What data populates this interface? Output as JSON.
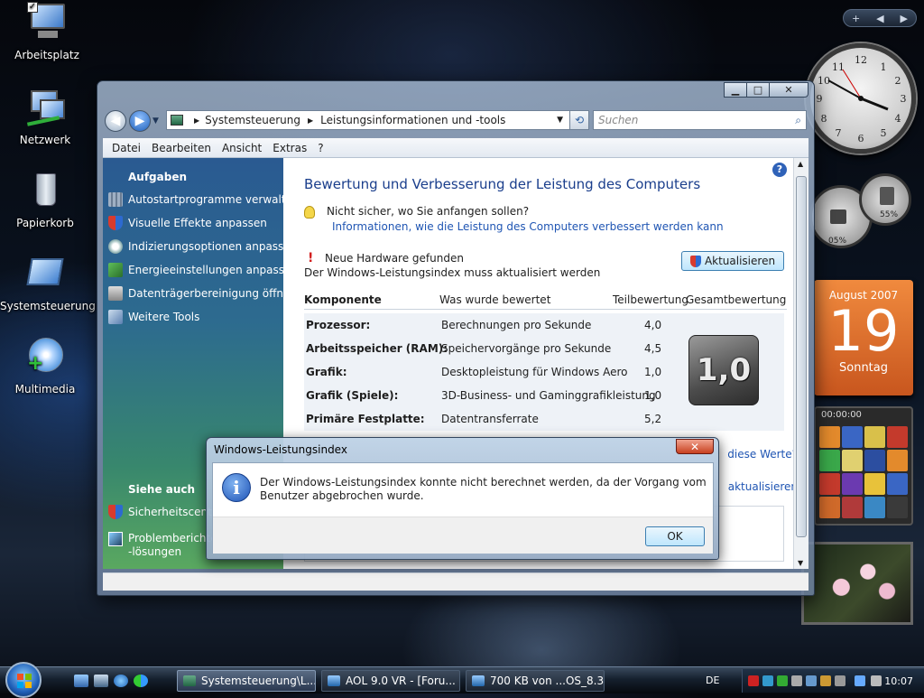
{
  "desktop": {
    "icons": [
      {
        "label": "Arbeitsplatz"
      },
      {
        "label": "Netzwerk"
      },
      {
        "label": "Papierkorb"
      },
      {
        "label": "Systemsteuerung"
      },
      {
        "label": "Multimedia"
      }
    ]
  },
  "gadgets": {
    "calendar_month": "August 2007",
    "calendar_day": "19",
    "calendar_weekday": "Sonntag",
    "gauge_cpu": "05%",
    "gauge_mem": "55%",
    "puzzle_time": "00:00:00"
  },
  "window": {
    "breadcrumb": [
      "Systemsteuerung",
      "Leistungsinformationen und -tools"
    ],
    "search_placeholder": "Suchen",
    "menu": [
      "Datei",
      "Bearbeiten",
      "Ansicht",
      "Extras",
      "?"
    ],
    "tasks_heading": "Aufgaben",
    "tasks": [
      "Autostartprogramme verwalten",
      "Visuelle Effekte anpassen",
      "Indizierungsoptionen anpassen",
      "Energieeinstellungen anpassen",
      "Datenträgerbereinigung öffnen",
      "Weitere Tools"
    ],
    "see_also_heading": "Siehe auch",
    "see_also": [
      "Sicherheitscenter",
      "Problemberichte",
      "-lösungen"
    ],
    "title": "Bewertung und Verbesserung der Leistung des Computers",
    "tip_heading": "Nicht sicher, wo Sie anfangen sollen?",
    "tip_link": "Informationen, wie die Leistung des Computers verbessert werden kann",
    "hw_heading": "Neue Hardware gefunden",
    "hw_text": "Der Windows-Leistungsindex muss aktualisiert werden",
    "update_button": "Aktualisieren",
    "table_headers": [
      "Komponente",
      "Was wurde bewertet",
      "Teilbewertung",
      "Gesamtbewertung"
    ],
    "rows": [
      {
        "component": "Prozessor:",
        "rated": "Berechnungen pro Sekunde",
        "score": "4,0"
      },
      {
        "component": "Arbeitsspeicher (RAM):",
        "rated": "Speichervorgänge pro Sekunde",
        "score": "4,5"
      },
      {
        "component": "Grafik:",
        "rated": "Desktopleistung für Windows Aero",
        "score": "1,0"
      },
      {
        "component": "Grafik (Spiele):",
        "rated": "3D-Business- und Gaminggrafikleistung",
        "score": "1,0"
      },
      {
        "component": "Primäre Festplatte:",
        "rated": "Datentransferrate",
        "score": "5,2"
      }
    ],
    "overall_score": "1,0",
    "link_values": "diese Werte?",
    "link_update": "aktualisieren"
  },
  "dialog": {
    "title": "Windows-Leistungsindex",
    "message": "Der Windows-Leistungsindex konnte nicht berechnet werden, da der Vorgang vom Benutzer abgebrochen wurde.",
    "ok": "OK",
    "close": "✕"
  },
  "taskbar": {
    "buttons": [
      "Systemsteuerung\\L...",
      "AOL 9.0 VR - [Foru...",
      "700 KB von ...OS_8.3..."
    ],
    "language": "DE",
    "time": "10:07"
  },
  "colors": {
    "link": "#1f55b3",
    "title": "#1a3e8c"
  }
}
